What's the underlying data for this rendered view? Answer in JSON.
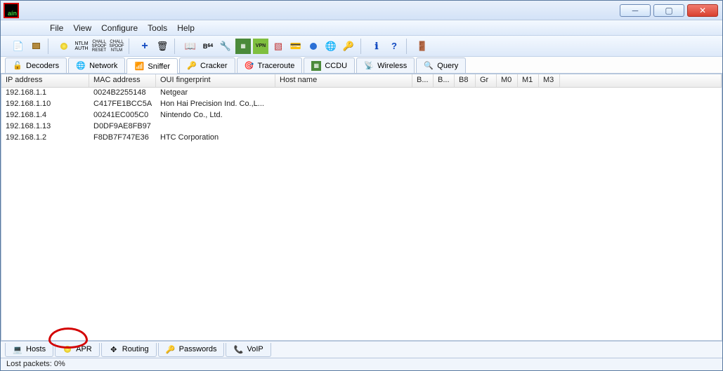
{
  "app_logo_text": "aín",
  "menu": {
    "file": "File",
    "view": "View",
    "configure": "Configure",
    "tools": "Tools",
    "help": "Help"
  },
  "upper_tabs": {
    "decoders": "Decoders",
    "network": "Network",
    "sniffer": "Sniffer",
    "cracker": "Cracker",
    "traceroute": "Traceroute",
    "ccdu": "CCDU",
    "wireless": "Wireless",
    "query": "Query"
  },
  "columns": {
    "ip": "IP address",
    "mac": "MAC address",
    "oui": "OUI fingerprint",
    "host": "Host name",
    "b1": "B...",
    "b2": "B...",
    "b8": "B8",
    "gr": "Gr",
    "m0": "M0",
    "m1": "M1",
    "m3": "M3"
  },
  "rows": [
    {
      "ip": "192.168.1.1",
      "mac": "0024B2255148",
      "oui": "Netgear",
      "host": ""
    },
    {
      "ip": "192.168.1.10",
      "mac": "C417FE1BCC5A",
      "oui": "Hon Hai Precision Ind. Co.,L...",
      "host": ""
    },
    {
      "ip": "192.168.1.4",
      "mac": "00241EC005C0",
      "oui": "Nintendo Co., Ltd.",
      "host": ""
    },
    {
      "ip": "192.168.1.13",
      "mac": "D0DF9AE8FB97",
      "oui": "",
      "host": ""
    },
    {
      "ip": "192.168.1.2",
      "mac": "F8DB7F747E36",
      "oui": "HTC Corporation",
      "host": ""
    }
  ],
  "lower_tabs": {
    "hosts": "Hosts",
    "apr": "APR",
    "routing": "Routing",
    "passwords": "Passwords",
    "voip": "VoIP"
  },
  "status": "Lost packets:  0%"
}
